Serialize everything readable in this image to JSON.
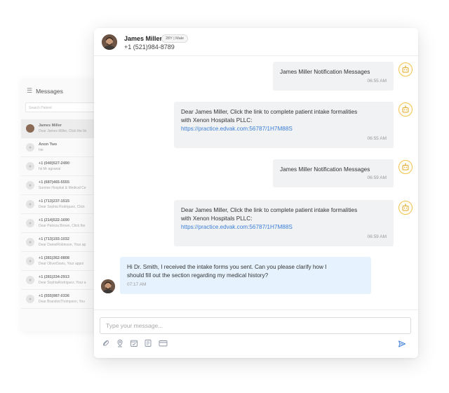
{
  "sidebar": {
    "title": "Messages",
    "search_placeholder": "Search Patient",
    "items": [
      {
        "name": "James Miller",
        "preview": "Dear James Miller, Click the lin"
      },
      {
        "name": "Anon Two",
        "preview": "hie"
      },
      {
        "name": "+1 (040)527-2490",
        "preview": "hii Mr agrawal"
      },
      {
        "name": "+1 (687)465-5555",
        "preview": "Sunrise Hospital & Medical Ce"
      },
      {
        "name": "+1 (713)237-1515",
        "preview": "Dear Sophia Rodriguez, Click"
      },
      {
        "name": "+1 (214)522-1690",
        "preview": "Dear Patricia Brown, Click the"
      },
      {
        "name": "+1 (713)193-1032",
        "preview": "Dear DanielRobinson, Your ap"
      },
      {
        "name": "+1 (281)362-0808",
        "preview": "Dear OliverDavis, Your appoi"
      },
      {
        "name": "+1 (281)334-2913",
        "preview": "Dear SophiaRodriguez, Your a"
      },
      {
        "name": "+1 (555)987-0336",
        "preview": "Dear BrandonThompson, You"
      }
    ]
  },
  "header": {
    "name": "James Miller",
    "badge": "28Y | Male",
    "phone": "+1 (521)984-8789"
  },
  "messages": [
    {
      "lines": [
        "James Miller Notification Messages"
      ],
      "link": "",
      "time": "06:55 AM"
    },
    {
      "lines": [
        "Dear James Miller, Click the link to complete patient intake formalities",
        "with Xenon Hospitals PLLC:"
      ],
      "link": "https://practice.edvak.com:56787/1H7M88S",
      "time": "06:55 AM"
    },
    {
      "lines": [
        "James Miller Notification Messages"
      ],
      "link": "",
      "time": "06:59 AM"
    },
    {
      "lines": [
        "Dear James Miller, Click the link to complete patient intake formalities",
        "with Xenon Hospitals PLLC:"
      ],
      "link": "https://practice.edvak.com:56787/1H7M88S",
      "time": "06:59 AM"
    },
    {
      "lines": [
        "Hi Dr. Smith, I received the intake forms you sent. Can you please clarify how I",
        "should fill out the section regarding my medical history?"
      ],
      "link": "",
      "time": "07:17 AM"
    }
  ],
  "composer": {
    "placeholder": "Type your message..."
  },
  "colors": {
    "accent": "#3b7ed6",
    "bot_icon": "#f3c34b",
    "incoming_bubble": "#e6f3fe",
    "outgoing_bubble": "#f1f2f4"
  },
  "icons": {
    "tools": [
      "paperclip-icon",
      "location-pin-icon",
      "calendar-check-icon",
      "document-icon",
      "card-icon"
    ],
    "send": "send-icon",
    "bot": "bot-icon"
  }
}
